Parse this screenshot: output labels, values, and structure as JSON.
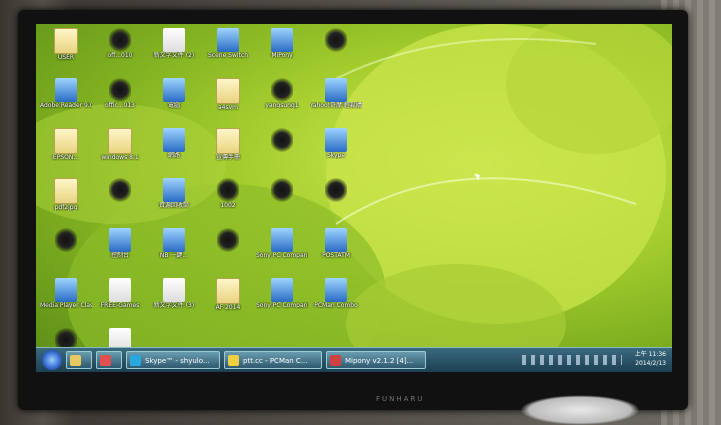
{
  "desktop": {
    "icons": [
      {
        "label": "USER",
        "kind": "folder"
      },
      {
        "label": "off...010",
        "kind": "blot"
      },
      {
        "label": "新文字文件 (2)",
        "kind": "doc"
      },
      {
        "label": "Scene Switch",
        "kind": "app"
      },
      {
        "label": "MiPony",
        "kind": "app"
      },
      {
        "label": "",
        "kind": "blot"
      },
      {
        "label": "Adobe Reader 9.0",
        "kind": "app"
      },
      {
        "label": "offic...013",
        "kind": "blot"
      },
      {
        "label": "電腦",
        "kind": "app"
      },
      {
        "label": "a4svm",
        "kind": "folder"
      },
      {
        "label": "yangsung1",
        "kind": "blot"
      },
      {
        "label": "Yahoo!奇摩 輕鬆購",
        "kind": "app"
      },
      {
        "label": "EPSON...",
        "kind": "folder"
      },
      {
        "label": "windows 8.1",
        "kind": "folder"
      },
      {
        "label": "網路",
        "kind": "app"
      },
      {
        "label": "宣傳手冊",
        "kind": "folder"
      },
      {
        "label": "",
        "kind": "blot"
      },
      {
        "label": "Skype",
        "kind": "app"
      },
      {
        "label": "pdf2jpg",
        "kind": "folder"
      },
      {
        "label": "",
        "kind": "blot"
      },
      {
        "label": "資源回收筒",
        "kind": "app"
      },
      {
        "label": "1002",
        "kind": "blot"
      },
      {
        "label": "",
        "kind": "blot"
      },
      {
        "label": "",
        "kind": "blot"
      },
      {
        "label": "",
        "kind": "blot"
      },
      {
        "label": "控制台",
        "kind": "app"
      },
      {
        "label": "NB 一鍵...",
        "kind": "app"
      },
      {
        "label": "",
        "kind": "blot"
      },
      {
        "label": "Sony PC Compani...",
        "kind": "app"
      },
      {
        "label": "POSTATM",
        "kind": "app"
      },
      {
        "label": "Media Player Classic",
        "kind": "app"
      },
      {
        "label": "FREE-Games",
        "kind": "doc"
      },
      {
        "label": "新文字文件 (3)",
        "kind": "doc"
      },
      {
        "label": "AF 2014",
        "kind": "folder"
      },
      {
        "label": "Sony PC Companio...",
        "kind": "app"
      },
      {
        "label": "PCMan Combo",
        "kind": "app"
      },
      {
        "label": "",
        "kind": "blot"
      },
      {
        "label": "新文字文件",
        "kind": "doc"
      }
    ]
  },
  "taskbar": {
    "items": [
      {
        "label": "",
        "kind": "folder"
      },
      {
        "label": "",
        "kind": "media"
      },
      {
        "label": "Skype™ - shyulo...",
        "kind": "skype"
      },
      {
        "label": "ptt.cc - PCMan C...",
        "kind": "pcman"
      },
      {
        "label": "Mipony v2.1.2 [4]...",
        "kind": "mipony"
      }
    ],
    "clock_time": "上午 11:36",
    "clock_date": "2014/2/13"
  },
  "monitor_brand": "FUNHARU",
  "colors": {
    "wallpaper": "#a8d030",
    "taskbar": "#2f5a70"
  }
}
